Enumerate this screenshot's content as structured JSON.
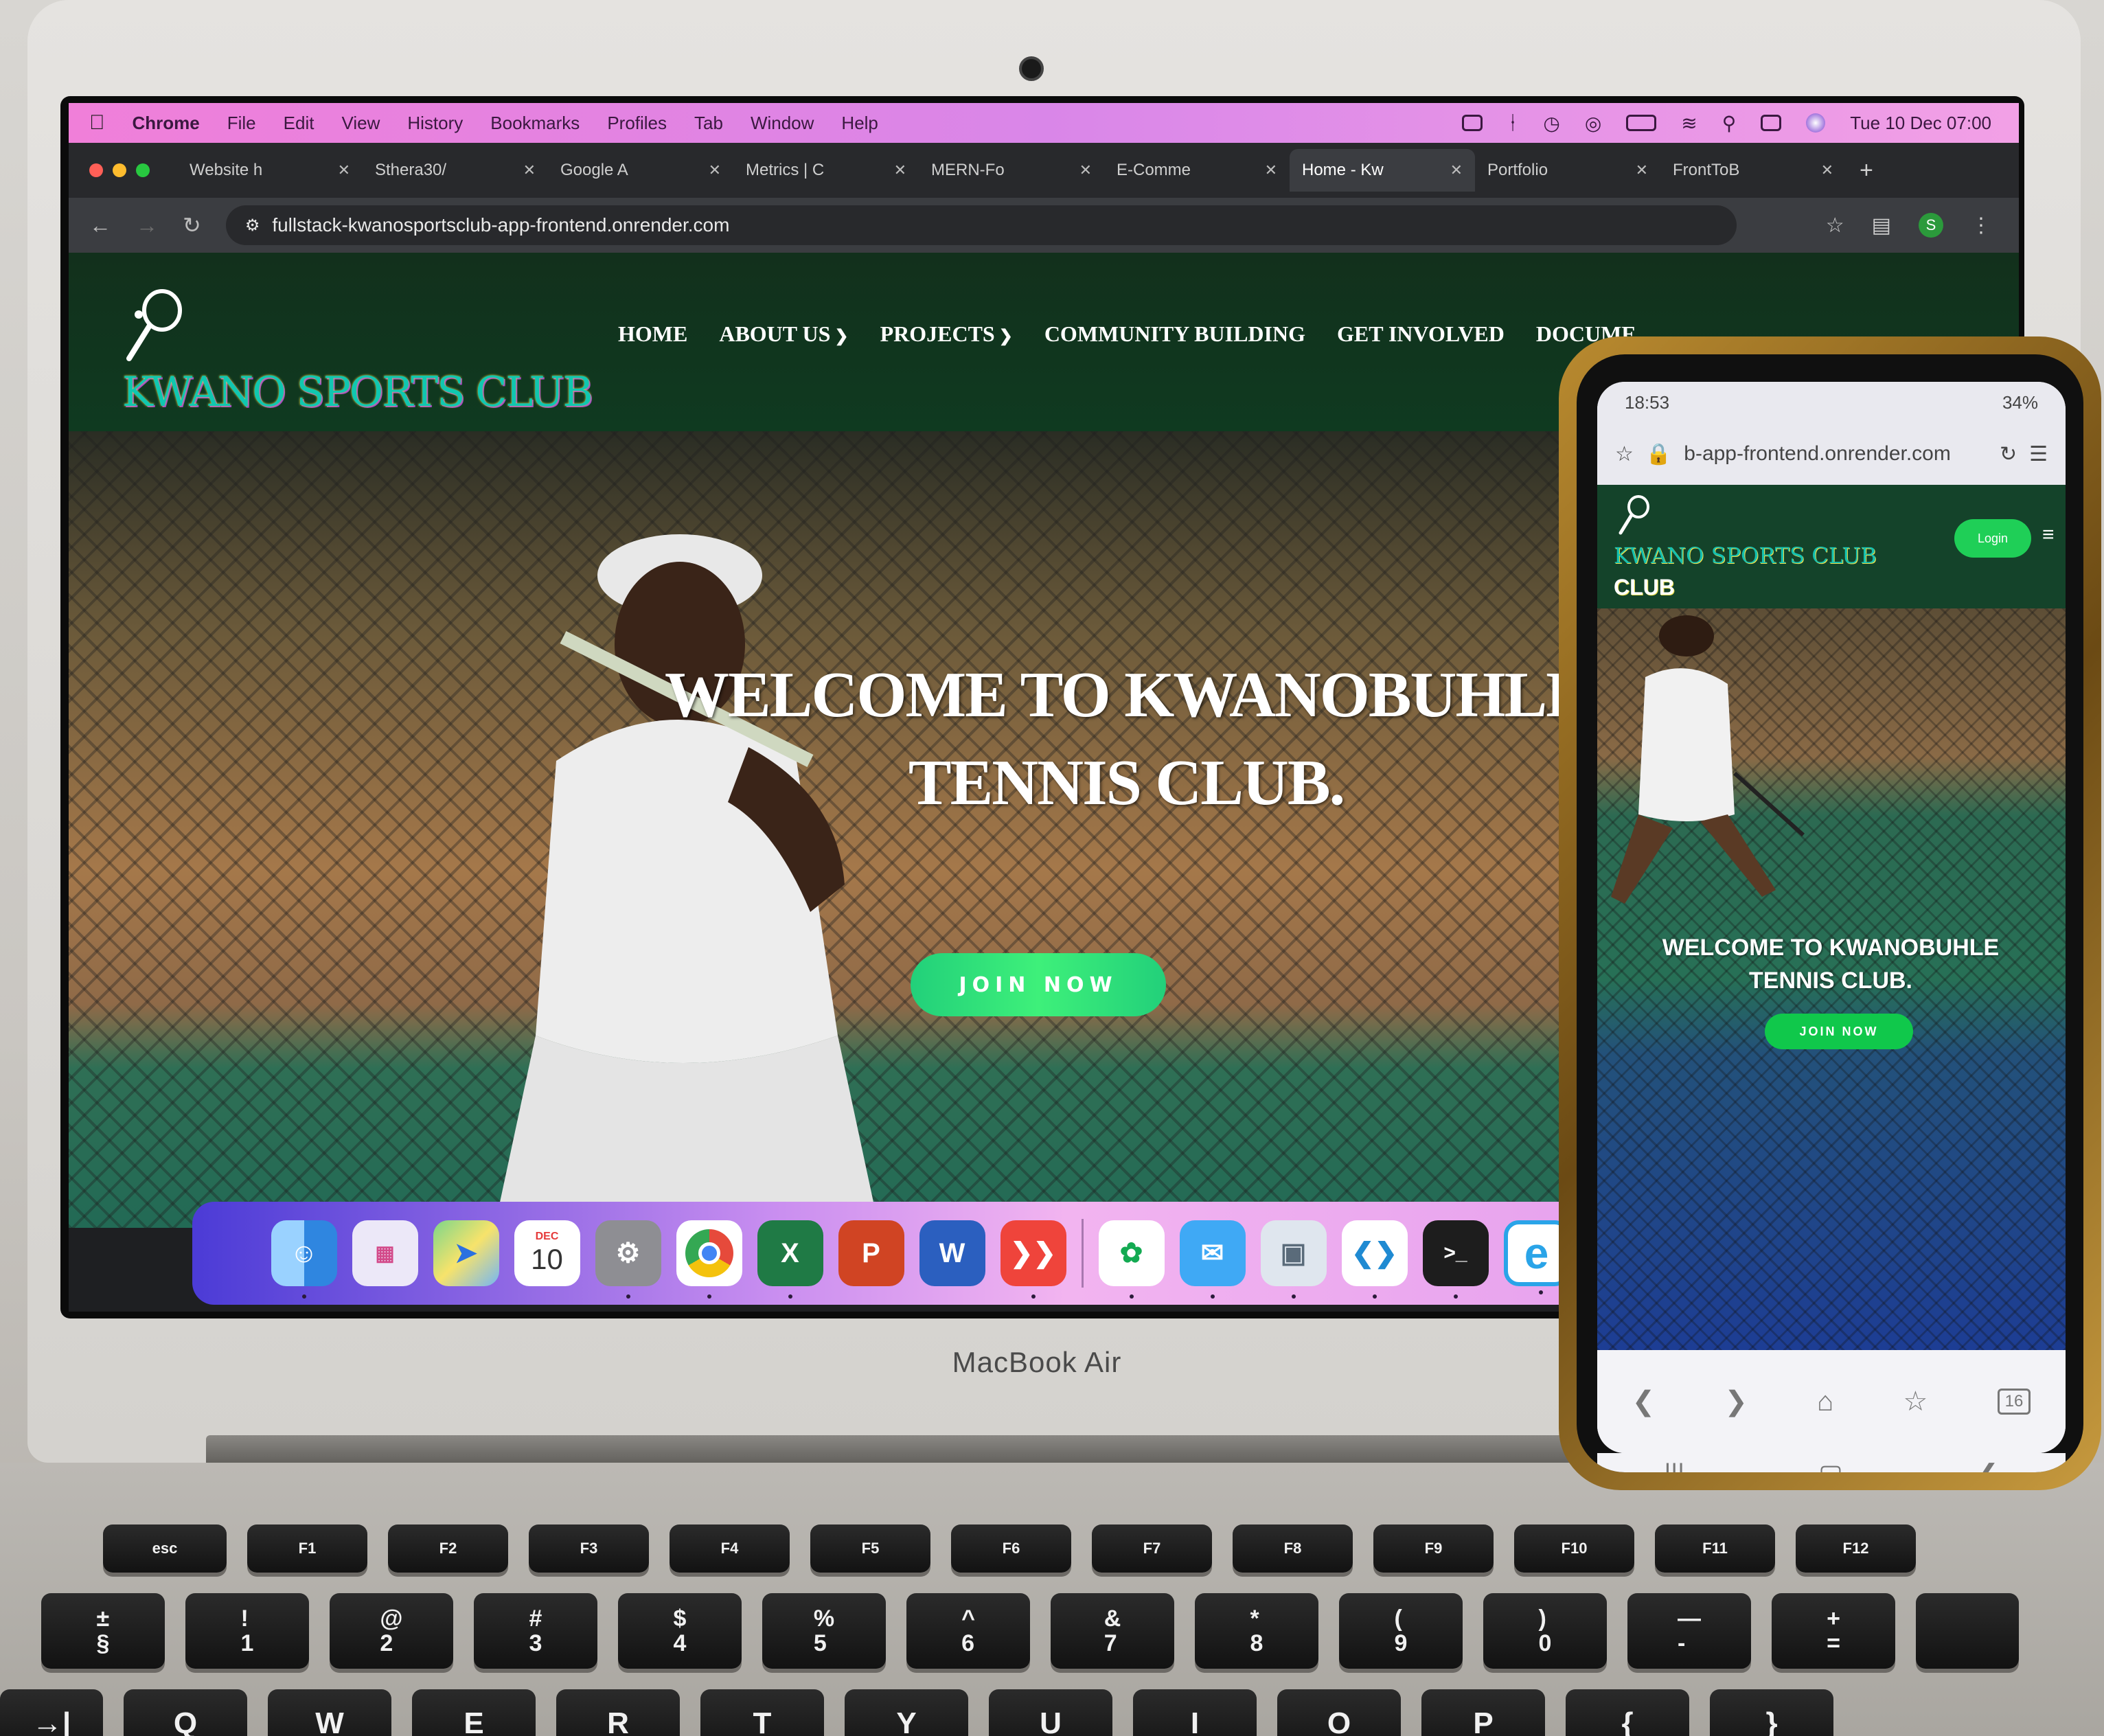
{
  "laptop": {
    "brand": "MacBook Air",
    "menubar": {
      "app": "Chrome",
      "items": [
        "File",
        "Edit",
        "View",
        "History",
        "Bookmarks",
        "Profiles",
        "Tab",
        "Window",
        "Help"
      ],
      "clock": "Tue 10 Dec 07:00",
      "status_icons": [
        "b-icon",
        "bluetooth-icon",
        "time-machine-icon",
        "airdrop-icon",
        "battery-icon",
        "wifi-icon",
        "search-icon",
        "control-center-icon",
        "siri-icon"
      ]
    },
    "browser": {
      "tabs": [
        {
          "title": "Website h"
        },
        {
          "title": "Sthera30/"
        },
        {
          "title": "Google A"
        },
        {
          "title": "Metrics | C"
        },
        {
          "title": "MERN-Fo"
        },
        {
          "title": "E-Comme"
        },
        {
          "title": "Home - Kw"
        },
        {
          "title": "Portfolio"
        },
        {
          "title": "FrontToB"
        }
      ],
      "active_tab_index": 6,
      "url": "fullstack-kwanosportsclub-app-frontend.onrender.com",
      "profile_initial": "S"
    },
    "site": {
      "logo_text": "KWANO SPORTS CLUB",
      "nav": [
        {
          "label": "HOME",
          "dropdown": false
        },
        {
          "label": "ABOUT US",
          "dropdown": true
        },
        {
          "label": "PROJECTS",
          "dropdown": true
        },
        {
          "label": "COMMUNITY BUILDING",
          "dropdown": false
        },
        {
          "label": "GET INVOLVED",
          "dropdown": false
        },
        {
          "label": "DOCUME",
          "dropdown": false
        }
      ],
      "hero_title": "WELCOME TO KWANOBUHLE TENNIS CLUB.",
      "hero_button": "JOIN NOW"
    },
    "dock": [
      {
        "name": "finder-icon",
        "color": "#4aa8f0"
      },
      {
        "name": "launchpad-icon",
        "color": "#e9e6f7"
      },
      {
        "name": "maps-icon",
        "color": "#6bd07a"
      },
      {
        "name": "calendar-icon",
        "color": "#ffffff",
        "label": "10",
        "sub": "DEC"
      },
      {
        "name": "system-settings-icon",
        "color": "#8e8e93"
      },
      {
        "name": "chrome-icon",
        "color": "#ffffff"
      },
      {
        "name": "excel-icon",
        "color": "#1f7a45",
        "label": "X"
      },
      {
        "name": "powerpoint-icon",
        "color": "#d04423",
        "label": "P"
      },
      {
        "name": "word-icon",
        "color": "#2b5fbf",
        "label": "W"
      },
      {
        "name": "anydesk-icon",
        "color": "#ef443b"
      },
      {
        "name": "mongodb-compass-icon",
        "color": "#ffffff"
      },
      {
        "name": "mail-icon",
        "color": "#3fa9f5"
      },
      {
        "name": "preview-icon",
        "color": "#dfe6ee"
      },
      {
        "name": "vscode-icon",
        "color": "#ffffff"
      },
      {
        "name": "terminal-icon",
        "color": "#1d1d1d",
        "label": ">_"
      },
      {
        "name": "edge-icon",
        "color": "#2aa4e8",
        "label": "e"
      }
    ]
  },
  "keyboard": {
    "fn_row": [
      "esc",
      "F1",
      "F2",
      "F3",
      "F4",
      "F5",
      "F6",
      "F7",
      "F8",
      "F9",
      "F10",
      "F11",
      "F12",
      ""
    ],
    "number_row": [
      "±\n§",
      "!\n1",
      "@\n2",
      "#\n3",
      "$\n4",
      "%\n5",
      "^\n6",
      "&\n7",
      "*\n8",
      "(\n9",
      ")\n0",
      "—\n-",
      "+\n="
    ],
    "letter_row": [
      "→|",
      "Q",
      "W",
      "E",
      "R",
      "T",
      "Y",
      "U",
      "I",
      "O",
      "P",
      "{",
      "}"
    ]
  },
  "phone": {
    "status_time": "18:53",
    "battery": "34%",
    "url": "b-app-frontend.onrender.com",
    "logo_line1": "KWANO SPORTS CLUB",
    "logo_line2": "CLUB",
    "login_label": "Login",
    "hero_title": "WELCOME TO KWANOBUHLE TENNIS CLUB.",
    "join_label": "JOIN NOW",
    "tabs_count": "16"
  }
}
